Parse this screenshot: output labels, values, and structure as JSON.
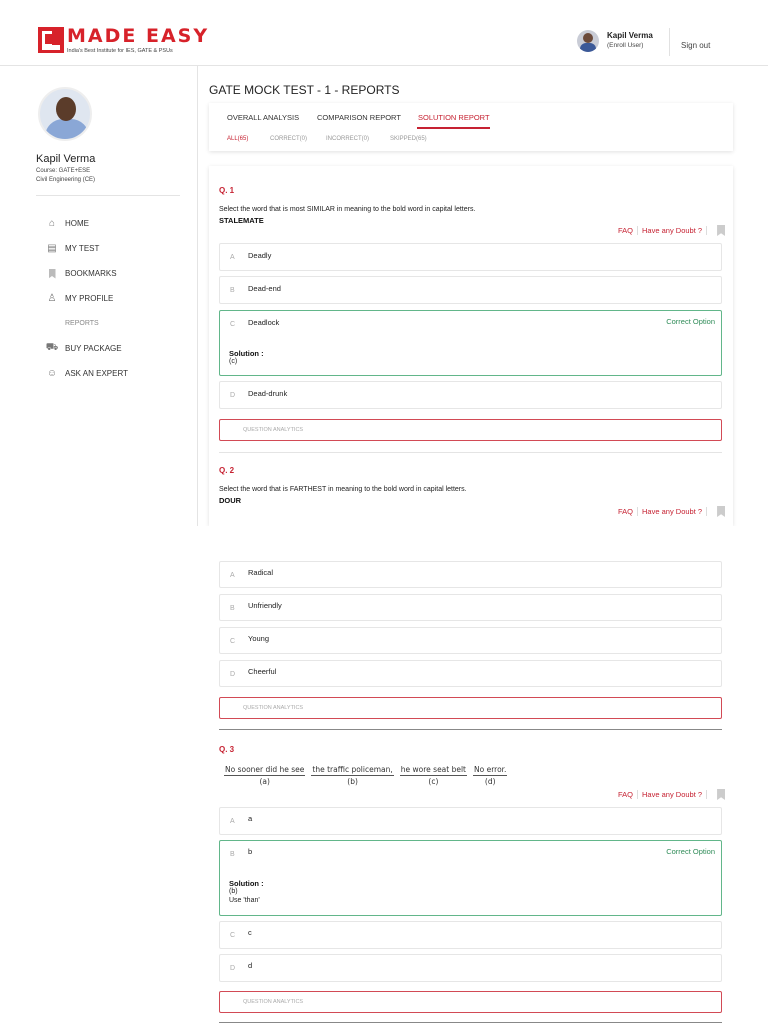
{
  "header": {
    "logo_name": "MADE EASY",
    "logo_tagline": "India's Best Institute for IES, GATE & PSUs",
    "user_name": "Kapil Verma",
    "user_role": "(Enroll User)",
    "signout_label": "Sign out"
  },
  "sidebar": {
    "name": "Kapil Verma",
    "course": "Course: GATE+ESE",
    "branch": "Civil Engineering (CE)",
    "menu": [
      {
        "label": "HOME",
        "icon": "home-icon"
      },
      {
        "label": "MY TEST",
        "icon": "test-icon"
      },
      {
        "label": "BOOKMARKS",
        "icon": "bookmark-icon"
      },
      {
        "label": "MY PROFILE",
        "icon": "profile-icon"
      },
      {
        "label": "REPORTS",
        "icon": ""
      },
      {
        "label": "BUY PACKAGE",
        "icon": "cart-icon"
      },
      {
        "label": "ASK AN EXPERT",
        "icon": "expert-icon"
      }
    ]
  },
  "main": {
    "title": "GATE MOCK TEST - 1 - REPORTS",
    "tabs": [
      "OVERALL ANALYSIS",
      "COMPARISON REPORT",
      "SOLUTION REPORT"
    ],
    "filters": [
      "ALL(65)",
      "CORRECT(0)",
      "INCORRECT(0)",
      "SKIPPED(65)"
    ],
    "faq_label": "FAQ",
    "doubt_label": "Have any Doubt ?",
    "correct_label": "Correct Option",
    "solution_label": "Solution :",
    "analytics_label": "QUESTION ANALYTICS"
  },
  "q1": {
    "num": "Q. 1",
    "text": "Select the word that is most SIMILAR in meaning to the bold word in capital letters.",
    "word": "STALEMATE",
    "options": [
      {
        "letter": "A",
        "text": "Deadly"
      },
      {
        "letter": "B",
        "text": "Dead-end"
      },
      {
        "letter": "C",
        "text": "Deadlock"
      },
      {
        "letter": "D",
        "text": "Dead-drunk"
      }
    ],
    "solution": "(c)"
  },
  "q2": {
    "num": "Q. 2",
    "text": "Select the word that is FARTHEST in meaning to the bold word in capital letters.",
    "word": "DOUR",
    "options": [
      {
        "letter": "A",
        "text": "Radical"
      },
      {
        "letter": "B",
        "text": "Unfriendly"
      },
      {
        "letter": "C",
        "text": "Young"
      },
      {
        "letter": "D",
        "text": "Cheerful"
      }
    ]
  },
  "q3": {
    "num": "Q. 3",
    "parts": [
      {
        "w": "No sooner did he see",
        "l": "(a)"
      },
      {
        "w": "the traffic policeman,",
        "l": "(b)"
      },
      {
        "w": "he wore seat belt",
        "l": "(c)"
      },
      {
        "w": "No error.",
        "l": "(d)"
      }
    ],
    "options": [
      {
        "letter": "A",
        "text": "a"
      },
      {
        "letter": "B",
        "text": "b"
      },
      {
        "letter": "C",
        "text": "c"
      },
      {
        "letter": "D",
        "text": "d"
      }
    ],
    "solution": "(b)",
    "solution_note": "Use 'than'"
  }
}
